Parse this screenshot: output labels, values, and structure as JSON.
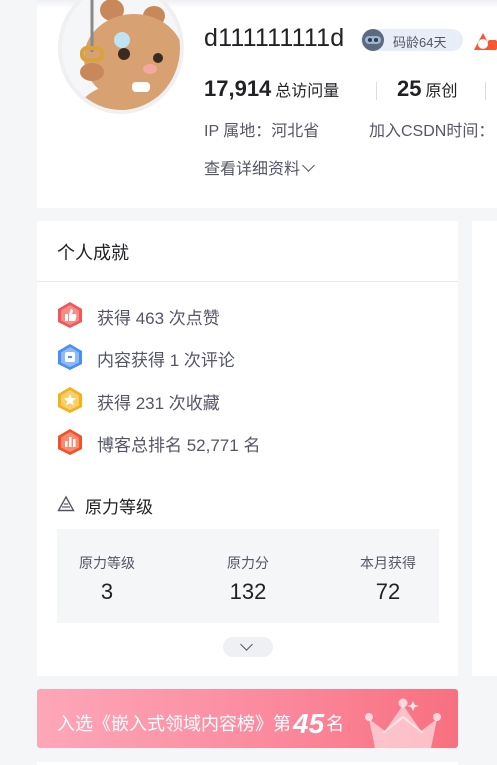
{
  "profile": {
    "username": "d111111111d",
    "badge_text": "码龄64天",
    "stats": [
      {
        "value": "17,914",
        "label": "总访问量"
      },
      {
        "value": "25",
        "label": "原创"
      }
    ],
    "ip_location": "IP 属地：河北省",
    "join_label": "加入CSDN时间：",
    "detail_link": "查看详细资料"
  },
  "achievements": {
    "title": "个人成就",
    "items": [
      {
        "icon": "thumbs-up-icon",
        "text": "获得 463 次点赞",
        "color": "#f25757"
      },
      {
        "icon": "comment-icon",
        "text": "内容获得 1 次评论",
        "color": "#4a8ff5"
      },
      {
        "icon": "star-icon",
        "text": "获得 231 次收藏",
        "color": "#f5b01a"
      },
      {
        "icon": "rank-chart-icon",
        "text": "博客总排名 52,771 名",
        "color": "#f5502d"
      }
    ],
    "yuanli": {
      "title": "原力等级",
      "columns": [
        {
          "label": "原力等级",
          "value": "3"
        },
        {
          "label": "原力分",
          "value": "132"
        },
        {
          "label": "本月获得",
          "value": "72"
        }
      ]
    }
  },
  "rank_banner": {
    "prefix": "入选《嵌入式领域内容榜》第",
    "number": "45",
    "suffix": "名"
  },
  "colors": {
    "accent_red": "#fc5531",
    "banner_start": "#fda7b9",
    "banner_end": "#f7707f"
  }
}
